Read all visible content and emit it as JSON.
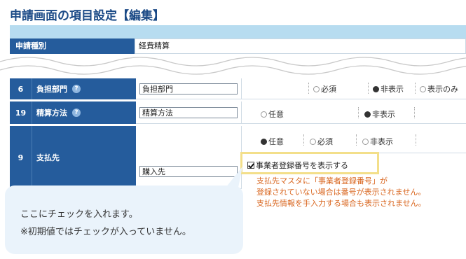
{
  "title": "申請画面の項目設定【編集】",
  "type_row": {
    "label": "申請種別",
    "value": "経費精算"
  },
  "rows": [
    {
      "num": "6",
      "name": "負担部門",
      "help": "?",
      "input": "負担部門",
      "options": [
        {
          "label": "必須",
          "selected": false
        },
        {
          "label": "非表示",
          "selected": true
        },
        {
          "label": "表示のみ",
          "selected": false
        }
      ]
    },
    {
      "num": "19",
      "name": "精算方法",
      "help": "?",
      "input": "精算方法",
      "options": [
        {
          "label": "任意",
          "selected": false
        },
        {
          "label": "非表示",
          "selected": true
        }
      ]
    },
    {
      "num": "9",
      "name": "支払先",
      "input": "購入先",
      "options": [
        {
          "label": "任意",
          "selected": true
        },
        {
          "label": "必須",
          "selected": false
        },
        {
          "label": "非表示",
          "selected": false
        }
      ],
      "checkbox_label": "事業者登録番号を表示する",
      "notes": [
        "支払先マスタに「事業者登録番号」が",
        "登録されていない場合は番号が表示されません。",
        "支払先情報を手入力する場合も表示されません。"
      ]
    }
  ],
  "callout": {
    "line1": "ここにチェックを入れます。",
    "line2": "※初期値ではチェックが入っていません。"
  },
  "colors": {
    "header": "#255c9c",
    "title": "#1b4a86",
    "note": "#d9661f",
    "highlight": "#f3df8a",
    "bubble": "#eaf3fb"
  }
}
